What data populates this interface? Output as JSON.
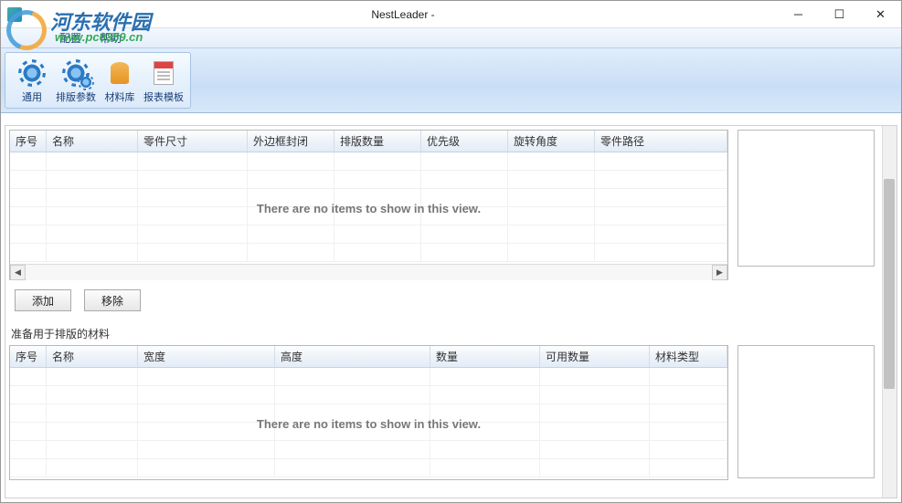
{
  "window": {
    "title": "NestLeader -"
  },
  "watermark": {
    "site_name": "河东软件园",
    "url": "www.pc0359.cn"
  },
  "menubar": {
    "items": [
      "配置",
      "帮助"
    ]
  },
  "ribbon": {
    "buttons": [
      {
        "label": "通用"
      },
      {
        "label": "排版参数"
      },
      {
        "label": "材料库"
      },
      {
        "label": "报表模板"
      }
    ]
  },
  "parts_table": {
    "columns": [
      "序号",
      "名称",
      "零件尺寸",
      "外边框封闭",
      "排版数量",
      "优先级",
      "旋转角度",
      "零件路径"
    ],
    "empty_message": "There are no items to show in this view."
  },
  "buttons": {
    "add": "添加",
    "remove": "移除"
  },
  "materials_section": {
    "label": "准备用于排版的材料"
  },
  "materials_table": {
    "columns": [
      "序号",
      "名称",
      "宽度",
      "高度",
      "数量",
      "可用数量",
      "材料类型"
    ],
    "empty_message": "There are no items to show in this view."
  }
}
